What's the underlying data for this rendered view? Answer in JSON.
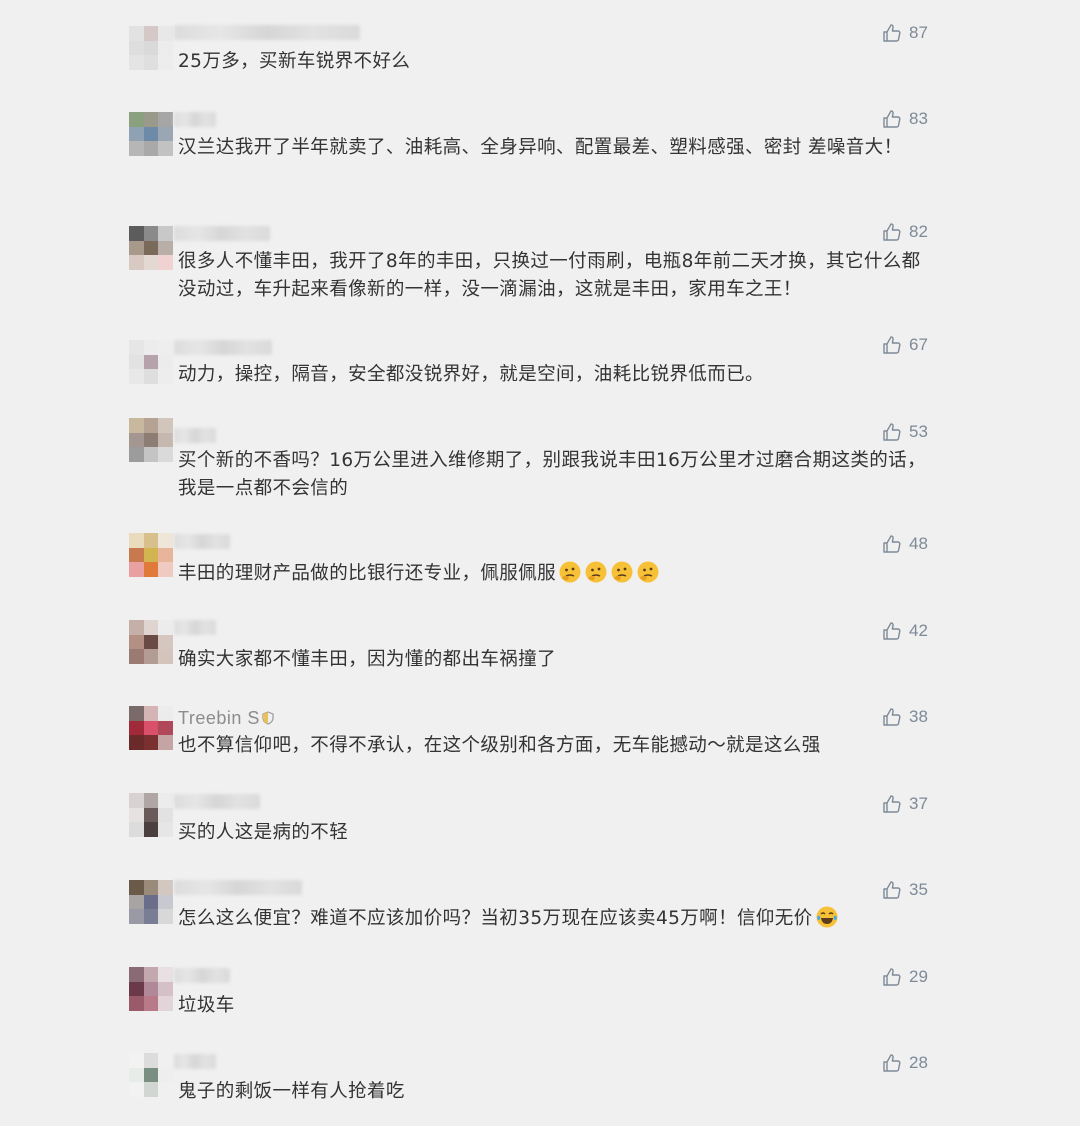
{
  "comments": [
    {
      "username": "",
      "text": "25万多，买新车锐界不好么",
      "likes": "87"
    },
    {
      "username": "",
      "text": "汉兰达我开了半年就卖了、油耗高、全身异响、配置最差、塑料感强、密封 差噪音大！",
      "likes": "83"
    },
    {
      "username": "",
      "text": "很多人不懂丰田，我开了8年的丰田，只换过一付雨刷，电瓶8年前二天才换，其它什么都没动过，车升起来看像新的一样，没一滴漏油，这就是丰田，家用车之王！",
      "likes": "82"
    },
    {
      "username": "",
      "text": "动力，操控，隔音，安全都没锐界好，就是空间，油耗比锐界低而已。",
      "likes": "67"
    },
    {
      "username": "",
      "text": "买个新的不香吗？16万公里进入维修期了，别跟我说丰田16万公里才过磨合期这类的话，我是一点都不会信的",
      "likes": "53"
    },
    {
      "username": "",
      "text": "丰田的理财产品做的比银行还专业，佩服佩服",
      "likes": "48",
      "emoji": "thinking-face-icon"
    },
    {
      "username": "",
      "text": "确实大家都不懂丰田，因为懂的都出车祸撞了",
      "likes": "42"
    },
    {
      "username": "Treebin S",
      "text": "也不算信仰吧，不得不承认，在这个级别和各方面，无车能撼动～就是这么强",
      "likes": "38"
    },
    {
      "username": "",
      "text": "买的人这是病的不轻",
      "likes": "37"
    },
    {
      "username": "",
      "text": "怎么这么便宜？难道不应该加价吗？当初35万现在应该卖45万啊！信仰无价",
      "likes": "35",
      "emoji": "laughing-tears-icon"
    },
    {
      "username": "",
      "text": "垃圾车",
      "likes": "29"
    },
    {
      "username": "",
      "text": "鬼子的剩饭一样有人抢着吃",
      "likes": "28"
    }
  ],
  "colors": {
    "background": "#f0f0f0",
    "text": "#333333",
    "like": "#7e8a98"
  }
}
